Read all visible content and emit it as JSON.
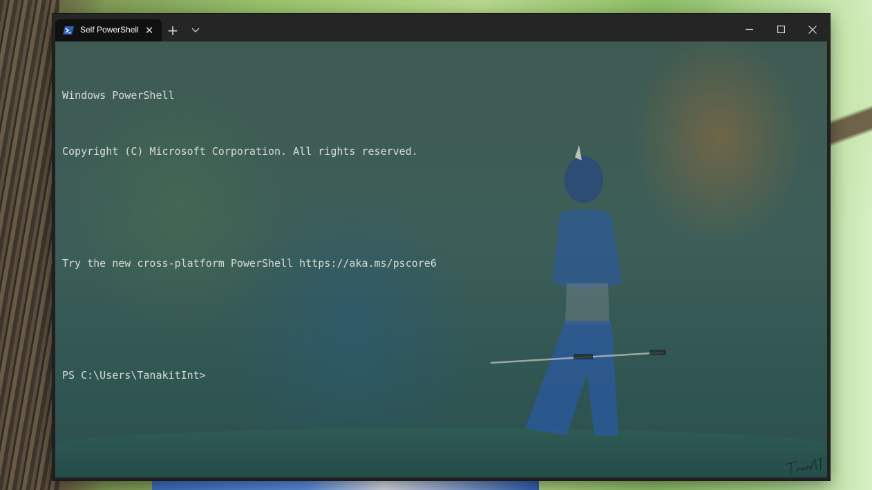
{
  "tab": {
    "title": "Self PowerShell",
    "icon": "powershell-icon",
    "close_icon": "close-icon"
  },
  "titlebar": {
    "new_tab_icon": "plus-icon",
    "dropdown_icon": "chevron-down-icon",
    "minimize_icon": "minimize-icon",
    "maximize_icon": "maximize-icon",
    "close_icon": "close-icon"
  },
  "terminal": {
    "lines": [
      "Windows PowerShell",
      "Copyright (C) Microsoft Corporation. All rights reserved.",
      "",
      "Try the new cross-platform PowerShell https://aka.ms/pscore6",
      "",
      "PS C:\\Users\\TanakitInt>"
    ]
  },
  "colors": {
    "window_bg": "#202020",
    "tab_bg": "#101010",
    "text": "#d6dcd6",
    "powershell_blue": "#2b5fb8"
  }
}
